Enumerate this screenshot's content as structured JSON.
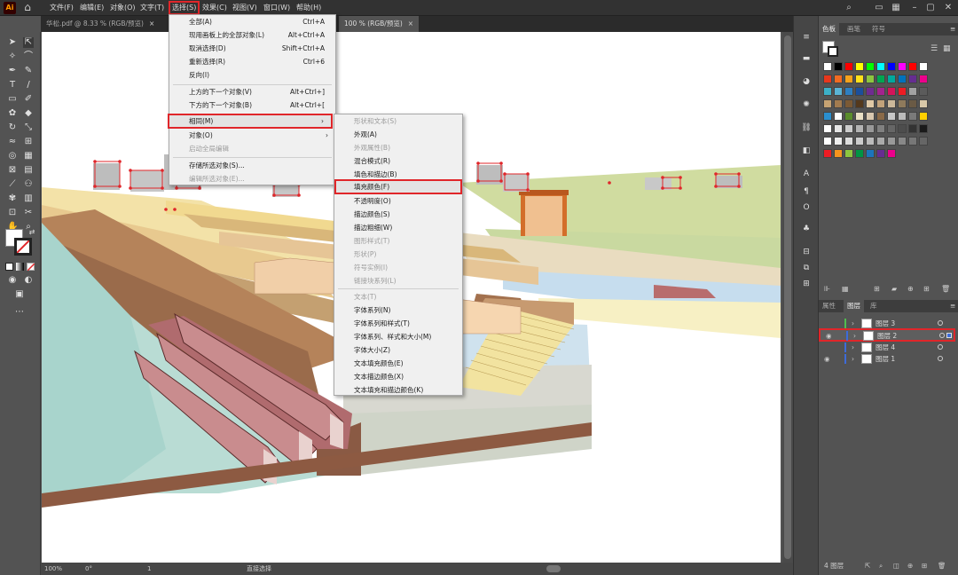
{
  "app": {
    "logo": "Ai"
  },
  "menubar": {
    "items": [
      "文件(F)",
      "编辑(E)",
      "对象(O)",
      "文字(T)",
      "选择(S)",
      "效果(C)",
      "视图(V)",
      "窗口(W)",
      "帮助(H)"
    ]
  },
  "tabs": [
    {
      "label": "华松.pdf @ 8.33 % (RGB/预览)",
      "close": "×"
    },
    {
      "label": "100 % (RGB/预览)",
      "close": "×"
    }
  ],
  "select_menu": {
    "items": [
      {
        "label": "全部(A)",
        "shortcut": "Ctrl+A"
      },
      {
        "label": "现用画板上的全部对象(L)",
        "shortcut": "Alt+Ctrl+A"
      },
      {
        "label": "取消选择(D)",
        "shortcut": "Shift+Ctrl+A"
      },
      {
        "label": "重新选择(R)",
        "shortcut": "Ctrl+6"
      },
      {
        "label": "反向(I)",
        "shortcut": ""
      },
      {
        "label": "上方的下一个对象(V)",
        "shortcut": "Alt+Ctrl+]"
      },
      {
        "label": "下方的下一个对象(B)",
        "shortcut": "Alt+Ctrl+["
      },
      {
        "label": "相同(M)",
        "shortcut": ""
      },
      {
        "label": "对象(O)",
        "shortcut": ""
      },
      {
        "label": "启动全局编辑",
        "shortcut": ""
      },
      {
        "label": "存储所选对象(S)...",
        "shortcut": ""
      },
      {
        "label": "编辑所选对象(E)...",
        "shortcut": ""
      }
    ]
  },
  "same_submenu": {
    "items": [
      {
        "label": "形状和文本(S)"
      },
      {
        "label": "外观(A)"
      },
      {
        "label": "外观属性(B)"
      },
      {
        "label": "混合模式(R)"
      },
      {
        "label": "填色和描边(B)"
      },
      {
        "label": "填充颜色(F)"
      },
      {
        "label": "不透明度(O)"
      },
      {
        "label": "描边颜色(S)"
      },
      {
        "label": "描边粗细(W)"
      },
      {
        "label": "图形样式(T)"
      },
      {
        "label": "形状(P)"
      },
      {
        "label": "符号实例(I)"
      },
      {
        "label": "链接块系列(L)"
      },
      {
        "label": "文本(T)"
      },
      {
        "label": "字体系列(N)"
      },
      {
        "label": "字体系列和样式(T)"
      },
      {
        "label": "字体系列、样式和大小(M)"
      },
      {
        "label": "字体大小(Z)"
      },
      {
        "label": "文本填充颜色(E)"
      },
      {
        "label": "文本描边颜色(X)"
      },
      {
        "label": "文本填充和描边颜色(K)"
      }
    ]
  },
  "panels": {
    "swatches_tabs": [
      "色板",
      "画笔",
      "符号"
    ],
    "layers_tabs": [
      "属性",
      "图层",
      "库"
    ],
    "layers": [
      {
        "name": "图层 3",
        "color": "#4fbd4f",
        "visible": false
      },
      {
        "name": "图层 2",
        "color": "#3d6bd9",
        "visible": true
      },
      {
        "name": "图层 4",
        "color": "#3d6bd9",
        "visible": false
      },
      {
        "name": "图层 1",
        "color": "#3d6bd9",
        "visible": true
      }
    ],
    "layers_footer": "4 图层"
  },
  "status": {
    "zoom": "100%",
    "rotation": "0°",
    "artboard": "1",
    "tool": "直接选择"
  }
}
